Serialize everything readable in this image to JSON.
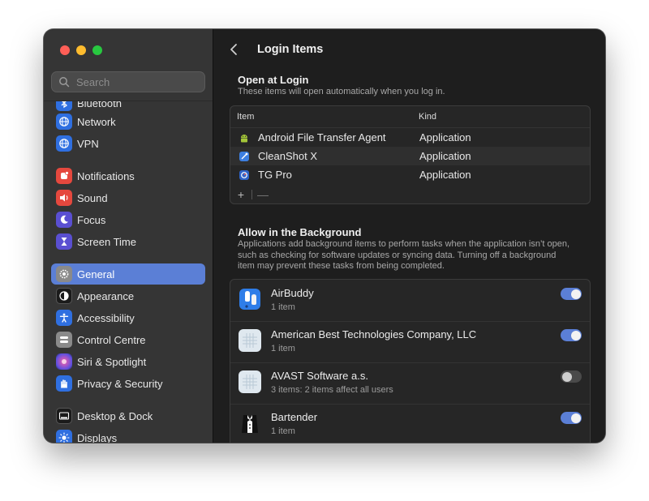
{
  "sidebar": {
    "search_placeholder": "Search",
    "items": [
      {
        "label": "Bluetooth",
        "icon": "bluetooth-icon",
        "color": "#2f6fe0"
      },
      {
        "label": "Network",
        "icon": "globe-icon",
        "color": "#2f6fe0"
      },
      {
        "label": "VPN",
        "icon": "vpn-icon",
        "color": "#2f6fe0"
      },
      {
        "label": "Notifications",
        "icon": "bell-icon",
        "color": "#e5483e"
      },
      {
        "label": "Sound",
        "icon": "speaker-icon",
        "color": "#e5483e"
      },
      {
        "label": "Focus",
        "icon": "moon-icon",
        "color": "#5a4fd1"
      },
      {
        "label": "Screen Time",
        "icon": "hourglass-icon",
        "color": "#5a4fd1"
      },
      {
        "label": "General",
        "icon": "gear-icon",
        "color": "#8a8a8a",
        "active": true
      },
      {
        "label": "Appearance",
        "icon": "appearance-icon",
        "color": "#1b1b1b"
      },
      {
        "label": "Accessibility",
        "icon": "accessibility-icon",
        "color": "#2f6fe0"
      },
      {
        "label": "Control Centre",
        "icon": "control-centre-icon",
        "color": "#8a8a8a"
      },
      {
        "label": "Siri & Spotlight",
        "icon": "siri-icon",
        "color": "#b04ad1"
      },
      {
        "label": "Privacy & Security",
        "icon": "hand-icon",
        "color": "#2f6fe0"
      },
      {
        "label": "Desktop & Dock",
        "icon": "dock-icon",
        "color": "#1b1b1b"
      },
      {
        "label": "Displays",
        "icon": "sun-icon",
        "color": "#2f6fe0"
      }
    ]
  },
  "header": {
    "title": "Login Items"
  },
  "open_at_login": {
    "title": "Open at Login",
    "description": "These items will open automatically when you log in.",
    "columns": [
      "Item",
      "Kind"
    ],
    "rows": [
      {
        "name": "Android File Transfer Agent",
        "kind": "Application",
        "icon": "android-icon"
      },
      {
        "name": "CleanShot X",
        "kind": "Application",
        "icon": "cleanshot-icon"
      },
      {
        "name": "TG Pro",
        "kind": "Application",
        "icon": "tgpro-icon"
      }
    ],
    "add_label": "+",
    "remove_label": "—"
  },
  "background": {
    "title": "Allow in the Background",
    "description": "Applications add background items to perform tasks when the application isn’t open, such as checking for software updates or syncing data. Turning off a background item may prevent these tasks from being completed.",
    "items": [
      {
        "name": "AirBuddy",
        "sub": "1 item",
        "enabled": true,
        "icon": "airbuddy-icon"
      },
      {
        "name": "American Best Technologies Company, LLC",
        "sub": "1 item",
        "enabled": true,
        "icon": "generic-app-icon"
      },
      {
        "name": "AVAST Software a.s.",
        "sub": "3 items: 2 items affect all users",
        "enabled": false,
        "icon": "generic-app-icon"
      },
      {
        "name": "Bartender",
        "sub": "1 item",
        "enabled": true,
        "icon": "bartender-icon"
      }
    ]
  },
  "colors": {
    "accent": "#5b7fd6",
    "sidebar_bg": "#353535",
    "main_bg": "#1e1e1e"
  }
}
